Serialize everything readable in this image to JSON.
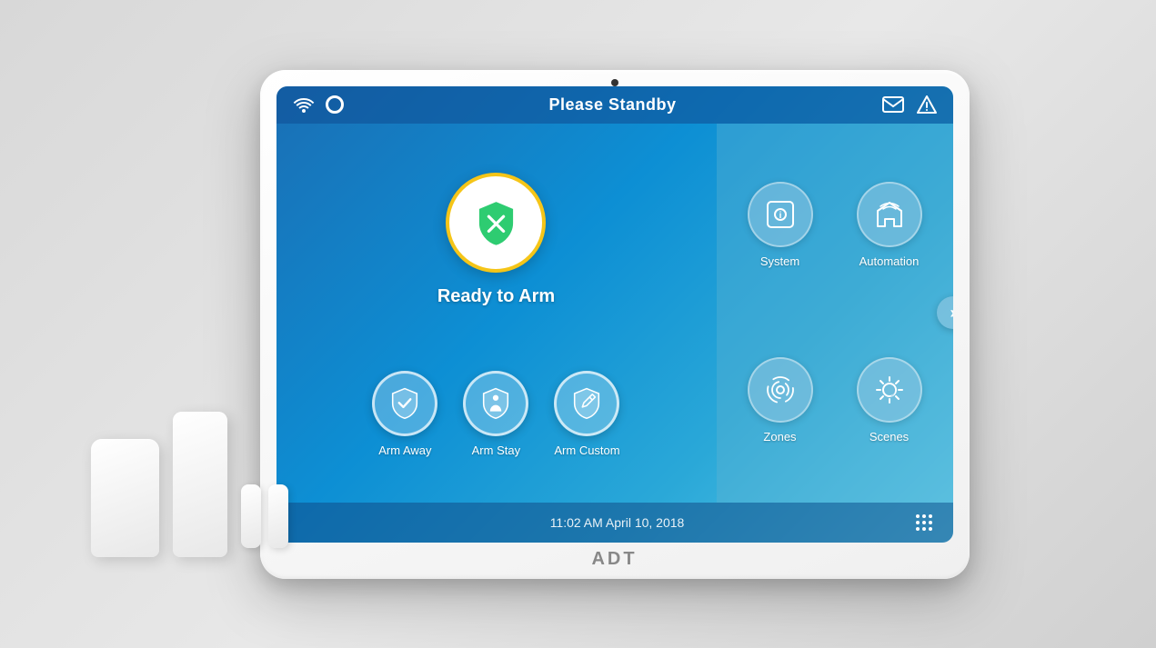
{
  "scene": {
    "background": "#e0e0e0"
  },
  "statusBar": {
    "title": "Please Standby",
    "icons": {
      "wifi": "📶",
      "mail": "✉",
      "warning": "⚠"
    }
  },
  "main": {
    "readyLabel": "Ready to Arm",
    "armButtons": [
      {
        "label": "Arm Away",
        "icon": "checkmark-shield"
      },
      {
        "label": "Arm Stay",
        "icon": "person-shield"
      },
      {
        "label": "Arm Custom",
        "icon": "pencil-shield"
      }
    ],
    "quickButtons": [
      [
        {
          "label": "System",
          "icon": "info-circle"
        },
        {
          "label": "Automation",
          "icon": "home-circle"
        }
      ],
      [
        {
          "label": "Zones",
          "icon": "wifi-waves"
        },
        {
          "label": "Scenes",
          "icon": "sun-moon"
        }
      ]
    ]
  },
  "bottomBar": {
    "datetime": "11:02 AM April 10, 2018"
  },
  "adt": {
    "logo": "ADT"
  }
}
